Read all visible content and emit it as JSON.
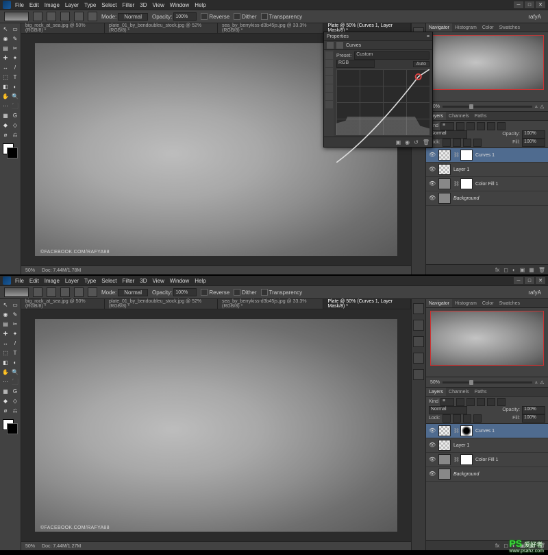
{
  "menu": {
    "items": [
      "File",
      "Edit",
      "Image",
      "Layer",
      "Type",
      "Select",
      "Filter",
      "3D",
      "View",
      "Window",
      "Help"
    ]
  },
  "user": "rafyA",
  "optbar": {
    "mode_label": "Mode:",
    "mode_value": "Normal",
    "opacity_label": "Opacity:",
    "opacity_value": "100%",
    "reverse": "Reverse",
    "dither": "Dither",
    "transparency": "Transparency"
  },
  "tabs": [
    "big_rock_at_sea.jpg @ 50% (RGB/8) *",
    "plate_01_by_bendoubleu_stock.jpg @ 52% (RGB/8) *",
    "sea_by_berrykiss-d3b45js.jpg @ 33.3% (RGB/8) *",
    "Plate @ 50% (Curves 1, Layer Mask/8) *"
  ],
  "active_tab": 3,
  "watermark": "©FACEBOOK.COM/RAFYA88",
  "status": {
    "zoom": "50%",
    "doc1": "Doc: 7.44M/1.78M",
    "doc2": "Doc: 7.44M/1.27M"
  },
  "panels": {
    "nav_tabs": [
      "Navigator",
      "Histogram",
      "Color",
      "Swatches"
    ],
    "nav_zoom": "50%",
    "layer_tabs": [
      "Layers",
      "Channels",
      "Paths"
    ],
    "kind": "Kind",
    "blend": "Normal",
    "opacity_label": "Opacity:",
    "opacity": "100%",
    "lock": "Lock:",
    "fill_label": "Fill:",
    "fill": "100%"
  },
  "layers": [
    {
      "name": "Curves 1",
      "sel": true,
      "thumb": "chk",
      "mask": "mask"
    },
    {
      "name": "Layer 1",
      "thumb": "chk"
    },
    {
      "name": "Color Fill 1",
      "thumb": "solid",
      "mask": "mask"
    },
    {
      "name": "Background",
      "it": true,
      "thumb": "solid"
    }
  ],
  "layers2": [
    {
      "name": "Curves 1",
      "sel": true,
      "thumb": "chk",
      "mask": "maskd"
    },
    {
      "name": "Layer 1",
      "thumb": "chk"
    },
    {
      "name": "Color Fill 1",
      "thumb": "solid",
      "mask": "mask"
    },
    {
      "name": "Background",
      "it": true,
      "thumb": "solid"
    }
  ],
  "props": {
    "title": "Properties",
    "adj": "Curves",
    "preset_label": "Preset:",
    "preset": "Custom",
    "channel": "RGB",
    "auto": "Auto"
  },
  "brand": {
    "name": "PS",
    "sub": "爱好者",
    "url": "www.psahz.com"
  }
}
